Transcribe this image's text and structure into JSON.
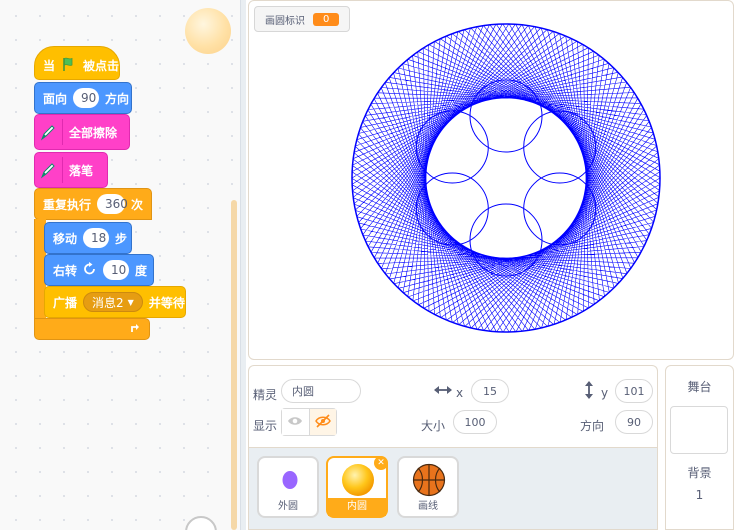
{
  "code": {
    "hat": {
      "prefix": "当",
      "suffix": "被点击"
    },
    "point_direction": {
      "label": "面向",
      "value": "90",
      "suffix": "方向"
    },
    "erase_all": {
      "label": "全部擦除"
    },
    "pen_down": {
      "label": "落笔"
    },
    "repeat": {
      "label": "重复执行",
      "value": "360",
      "suffix": "次"
    },
    "move": {
      "label": "移动",
      "value": "18",
      "suffix": "步"
    },
    "turn": {
      "label": "右转",
      "value": "10",
      "suffix": "度"
    },
    "broadcast": {
      "label": "广播",
      "message": "消息2",
      "suffix": "并等待"
    }
  },
  "stage": {
    "monitor": {
      "label": "画圆标识",
      "value": "0"
    },
    "drawing_color": "#0000ff"
  },
  "sprite_info": {
    "sprite_label": "精灵",
    "sprite_name": "内圆",
    "x_label": "x",
    "x_value": "15",
    "y_label": "y",
    "y_value": "101",
    "show_label": "显示",
    "size_label": "大小",
    "size_value": "100",
    "direction_label": "方向",
    "direction_value": "90"
  },
  "sprites": [
    {
      "name": "外圆",
      "selected": false
    },
    {
      "name": "内圆",
      "selected": true
    },
    {
      "name": "画线",
      "selected": false
    }
  ],
  "stage_pane": {
    "title": "舞台",
    "backdrop_label": "背景",
    "backdrop_count": "1"
  },
  "colors": {
    "events": "#ffbf00",
    "motion": "#4c97ff",
    "pen": "#ff40c8",
    "control": "#ffab19"
  }
}
